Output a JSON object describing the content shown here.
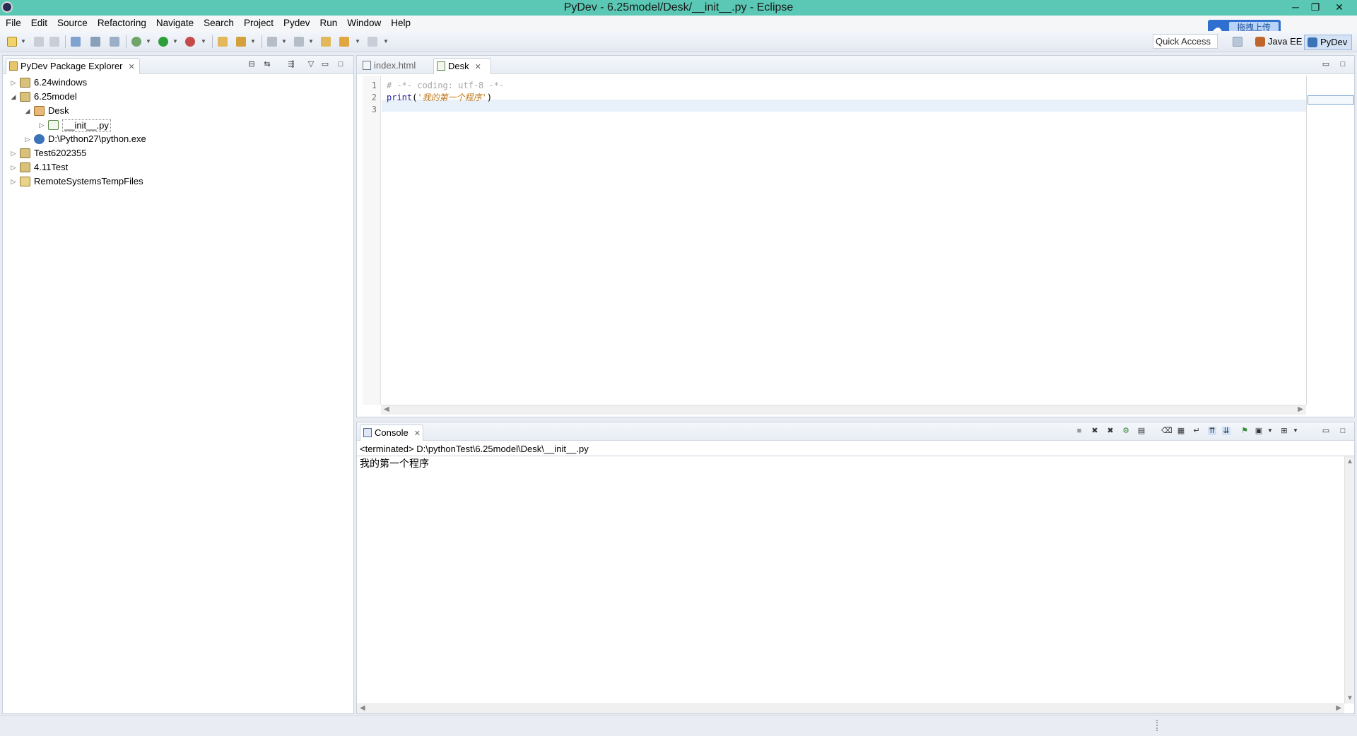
{
  "window": {
    "title": "PyDev - 6.25model/Desk/__init__.py - Eclipse",
    "controls": {
      "minimize": "─",
      "restore": "❐",
      "close": "✕"
    }
  },
  "menubar": {
    "items": [
      "File",
      "Edit",
      "Source",
      "Refactoring",
      "Navigate",
      "Search",
      "Project",
      "Pydev",
      "Run",
      "Window",
      "Help"
    ]
  },
  "toolbar": {
    "quick_access": "Quick Access",
    "upload_label": "拖拽上传",
    "perspectives": [
      {
        "label": "Java EE",
        "icon": "java-ee-icon",
        "color": "#c0652b"
      },
      {
        "label": "PyDev",
        "icon": "pydev-icon",
        "color": "#3a73b8"
      }
    ]
  },
  "package_explorer": {
    "title": "PyDev Package Explorer",
    "tree": [
      {
        "label": "6.24windows",
        "expanded": false,
        "icon": "project-icon"
      },
      {
        "label": "6.25model",
        "expanded": true,
        "icon": "project-icon"
      },
      {
        "label": "Desk",
        "expanded": true,
        "icon": "package-icon"
      },
      {
        "label": "__init__.py",
        "expanded": false,
        "icon": "python-file-icon"
      },
      {
        "label": "D:\\Python27\\python.exe",
        "expanded": false,
        "icon": "interpreter-icon"
      },
      {
        "label": "Test6202355",
        "expanded": false,
        "icon": "project-icon"
      },
      {
        "label": "4.11Test",
        "expanded": false,
        "icon": "project-icon"
      },
      {
        "label": "RemoteSystemsTempFiles",
        "expanded": false,
        "icon": "folder-icon"
      }
    ]
  },
  "editor": {
    "tabs": [
      {
        "label": "index.html",
        "active": false
      },
      {
        "label": "Desk",
        "active": true
      }
    ],
    "lines": [
      {
        "num": "1",
        "parts": [
          {
            "t": "# -*- coding: utf-8 -*-",
            "c": "cmt"
          }
        ]
      },
      {
        "num": "2",
        "parts": [
          {
            "t": "print",
            "c": "kw"
          },
          {
            "t": "(",
            "c": ""
          },
          {
            "t": "'我的第一个程序'",
            "c": "str"
          },
          {
            "t": ")",
            "c": ""
          }
        ]
      },
      {
        "num": "3",
        "parts": []
      }
    ]
  },
  "console": {
    "title": "Console",
    "header": "<terminated> D:\\pythonTest\\6.25model\\Desk\\__init__.py",
    "output": "我的第一个程序"
  },
  "colors": {
    "titlebar": "#5ac8b4",
    "current_line": "#e8f0fa",
    "keyword": "#1d1d9c",
    "string": "#c07a1a"
  }
}
